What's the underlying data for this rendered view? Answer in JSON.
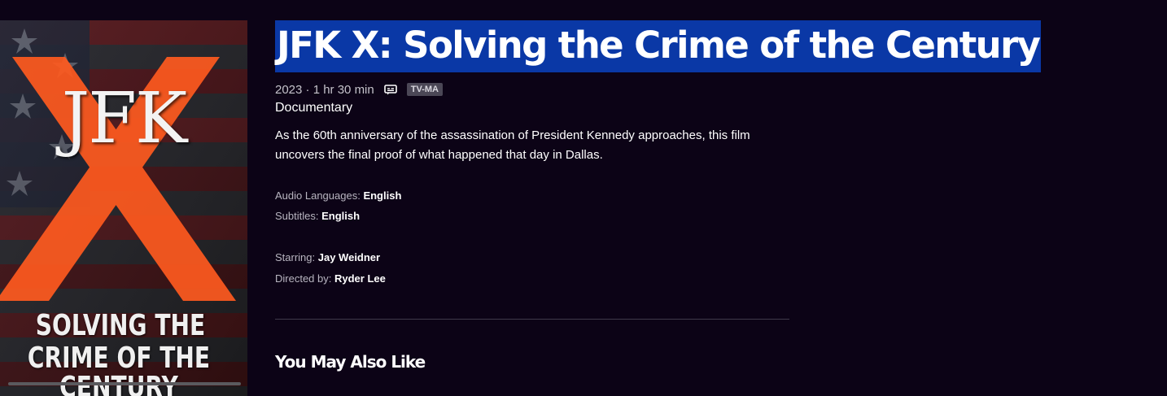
{
  "poster": {
    "title_art": "JFK",
    "subtitle_line1": "SOLVING THE",
    "subtitle_line2": "CRIME OF THE CENTURY"
  },
  "movie": {
    "title": "JFK X: Solving the Crime of the Century",
    "year_runtime": "2023 · 1 hr 30 min",
    "rating": "TV-MA",
    "genre": "Documentary",
    "description": "As the 60th anniversary of the assassination of President Kennedy approaches, this film uncovers the final proof of what happened that day in Dallas."
  },
  "details": {
    "audio_label": "Audio Languages:",
    "audio_value": "English",
    "subtitles_label": "Subtitles:",
    "subtitles_value": "English",
    "starring_label": "Starring:",
    "starring_value": "Jay Weidner",
    "directed_label": "Directed by:",
    "directed_value": "Ryder Lee"
  },
  "sections": {
    "also_like": "You May Also Like"
  },
  "colors": {
    "background": "#0c0316",
    "title_highlight": "#0a38a6",
    "poster_x": "#ff5a1f"
  },
  "icons": {
    "captions": "closed-captions-icon"
  }
}
